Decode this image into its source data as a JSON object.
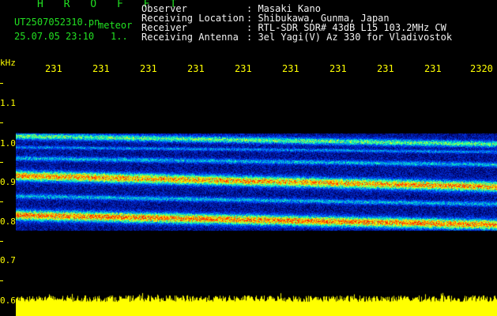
{
  "header": {
    "title": "H R O F F T",
    "filename": "UT2507052310.pn",
    "type": "meteor",
    "datetime": "25.07.05 23:10",
    "indicator": "1..",
    "fields": [
      {
        "label": "Observer",
        "value": ": Masaki Kano"
      },
      {
        "label": "Receiving Location",
        "value": ": Shibukawa, Gunma, Japan"
      },
      {
        "label": "Receiver",
        "value": ": RTL-SDR SDR# 43dB L15 103.2MHz CW"
      },
      {
        "label": "Receiving Antenna",
        "value": ": 3el Yagi(V) Az 330 for Vladivostok"
      }
    ]
  },
  "xaxis": {
    "ticks": [
      "231",
      "231",
      "231",
      "231",
      "231",
      "231",
      "231",
      "231",
      "231",
      "2320"
    ]
  },
  "yaxis": {
    "unit": "kHz",
    "labels": [
      "1.1",
      "1.0",
      "0.9",
      "0.8",
      "0.7",
      "0.6"
    ]
  },
  "colors": {
    "background": "#000000",
    "title": "#22e022",
    "text": "#f2f2f2",
    "axis": "#ffff00",
    "waveform": "#ffff00"
  }
}
